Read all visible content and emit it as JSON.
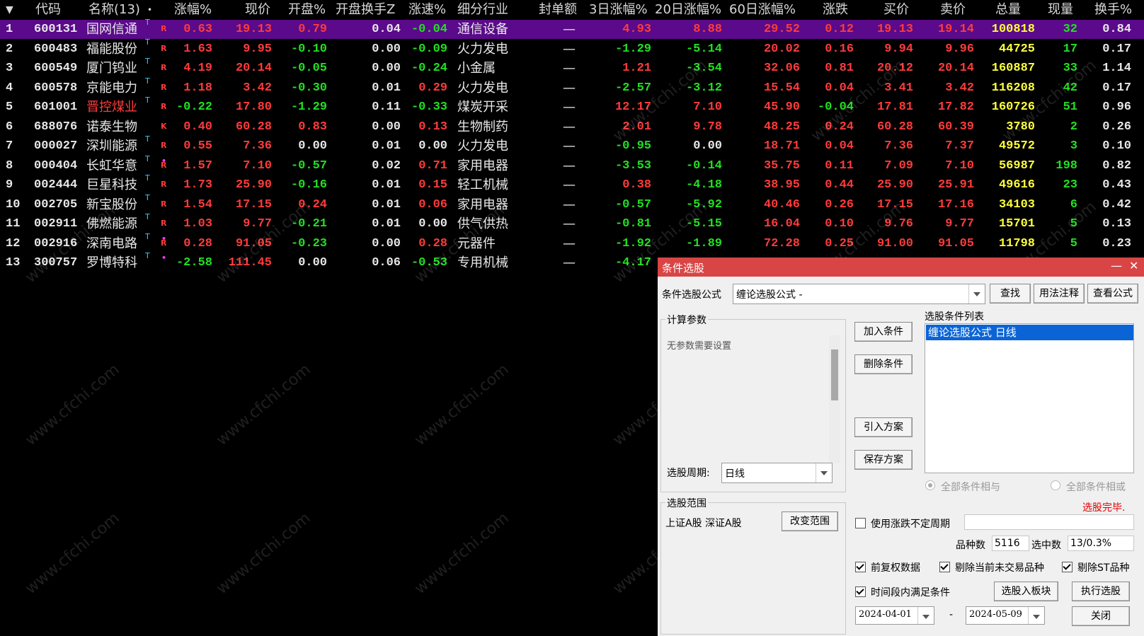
{
  "table": {
    "header": {
      "sort_arrow": "▼",
      "code": "代码",
      "name": "名称(13)",
      "name_dot": "•",
      "chg": "涨幅%",
      "price": "现价",
      "open_pct": "开盘%",
      "open_turn": "开盘换手Z",
      "speed": "涨速%",
      "industry": "细分行业",
      "seal": "封单额",
      "d3": "3日涨幅%",
      "d20": "20日涨幅%",
      "d60": "60日涨幅%",
      "updown": "涨跌",
      "bid": "买价",
      "ask": "卖价",
      "vol": "总量",
      "cur": "现量",
      "turn": "换手%"
    },
    "rows": [
      {
        "no": "1",
        "code": "600131",
        "name": "国网信通",
        "t": "T",
        "mark": "R",
        "chg": "0.63",
        "price": "19.13",
        "open": "0.79",
        "oturn": "0.04",
        "speed": "-0.04",
        "ind": "通信设备",
        "seal": "—",
        "d3": "4.93",
        "d20": "8.88",
        "d60": "29.52",
        "ud": "0.12",
        "bid": "19.13",
        "ask": "19.14",
        "vol": "100818",
        "cur": "32",
        "turn": "0.84",
        "selected": true
      },
      {
        "no": "2",
        "code": "600483",
        "name": "福能股份",
        "t": "T",
        "mark": "R",
        "chg": "1.63",
        "price": "9.95",
        "open": "-0.10",
        "oturn": "0.00",
        "speed": "-0.09",
        "ind": "火力发电",
        "seal": "—",
        "d3": "-1.29",
        "d20": "-5.14",
        "d60": "20.02",
        "ud": "0.16",
        "bid": "9.94",
        "ask": "9.96",
        "vol": "44725",
        "cur": "17",
        "turn": "0.17"
      },
      {
        "no": "3",
        "code": "600549",
        "name": "厦门钨业",
        "t": "T",
        "mark": "R",
        "chg": "4.19",
        "price": "20.14",
        "open": "-0.05",
        "oturn": "0.00",
        "speed": "-0.24",
        "ind": "小金属",
        "seal": "—",
        "d3": "1.21",
        "d20": "-3.54",
        "d60": "32.06",
        "ud": "0.81",
        "bid": "20.12",
        "ask": "20.14",
        "vol": "160887",
        "cur": "33",
        "turn": "1.14"
      },
      {
        "no": "4",
        "code": "600578",
        "name": "京能电力",
        "t": "T",
        "mark": "R",
        "chg": "1.18",
        "price": "3.42",
        "open": "-0.30",
        "oturn": "0.01",
        "speed": "0.29",
        "ind": "火力发电",
        "seal": "—",
        "d3": "-2.57",
        "d20": "-3.12",
        "d60": "15.54",
        "ud": "0.04",
        "bid": "3.41",
        "ask": "3.42",
        "vol": "116208",
        "cur": "42",
        "turn": "0.17"
      },
      {
        "no": "5",
        "code": "601001",
        "name": "晋控煤业",
        "t": "T",
        "mark": "R",
        "chg": "-0.22",
        "price": "17.80",
        "open": "-1.29",
        "oturn": "0.11",
        "speed": "-0.33",
        "ind": "煤炭开采",
        "seal": "—",
        "d3": "12.17",
        "d20": "7.10",
        "d60": "45.90",
        "ud": "-0.04",
        "bid": "17.81",
        "ask": "17.82",
        "vol": "160726",
        "cur": "51",
        "turn": "0.96",
        "name_red": true
      },
      {
        "no": "6",
        "code": "688076",
        "name": "诺泰生物",
        "t": "",
        "mark": "K",
        "chg": "0.40",
        "price": "60.28",
        "open": "0.83",
        "oturn": "0.00",
        "speed": "0.13",
        "ind": "生物制药",
        "seal": "—",
        "d3": "2.01",
        "d20": "9.78",
        "d60": "48.25",
        "ud": "0.24",
        "bid": "60.28",
        "ask": "60.39",
        "vol": "3780",
        "cur": "2",
        "turn": "0.26"
      },
      {
        "no": "7",
        "code": "000027",
        "name": "深圳能源",
        "t": "T",
        "mark": "R",
        "chg": "0.55",
        "price": "7.36",
        "open": "0.00",
        "oturn": "0.01",
        "speed": "0.00",
        "ind": "火力发电",
        "seal": "—",
        "d3": "-0.95",
        "d20": "0.00",
        "d60": "18.71",
        "ud": "0.04",
        "bid": "7.36",
        "ask": "7.37",
        "vol": "49572",
        "cur": "3",
        "turn": "0.10"
      },
      {
        "no": "8",
        "code": "000404",
        "name": "长虹华意",
        "t": "T",
        "mark": "R",
        "chg": "1.57",
        "price": "7.10",
        "open": "-0.57",
        "oturn": "0.02",
        "speed": "0.71",
        "ind": "家用电器",
        "seal": "—",
        "d3": "-3.53",
        "d20": "-0.14",
        "d60": "35.75",
        "ud": "0.11",
        "bid": "7.09",
        "ask": "7.10",
        "vol": "56987",
        "cur": "198",
        "turn": "0.82",
        "dot": true
      },
      {
        "no": "9",
        "code": "002444",
        "name": "巨星科技",
        "t": "T",
        "mark": "R",
        "chg": "1.73",
        "price": "25.90",
        "open": "-0.16",
        "oturn": "0.01",
        "speed": "0.15",
        "ind": "轻工机械",
        "seal": "—",
        "d3": "0.38",
        "d20": "-4.18",
        "d60": "38.95",
        "ud": "0.44",
        "bid": "25.90",
        "ask": "25.91",
        "vol": "49616",
        "cur": "23",
        "turn": "0.43"
      },
      {
        "no": "10",
        "code": "002705",
        "name": "新宝股份",
        "t": "T",
        "mark": "R",
        "chg": "1.54",
        "price": "17.15",
        "open": "0.24",
        "oturn": "0.01",
        "speed": "0.06",
        "ind": "家用电器",
        "seal": "—",
        "d3": "-0.57",
        "d20": "-5.92",
        "d60": "40.46",
        "ud": "0.26",
        "bid": "17.15",
        "ask": "17.16",
        "vol": "34103",
        "cur": "6",
        "turn": "0.42"
      },
      {
        "no": "11",
        "code": "002911",
        "name": "佛燃能源",
        "t": "T",
        "mark": "R",
        "chg": "1.03",
        "price": "9.77",
        "open": "-0.21",
        "oturn": "0.01",
        "speed": "0.00",
        "ind": "供气供热",
        "seal": "—",
        "d3": "-0.81",
        "d20": "-5.15",
        "d60": "16.04",
        "ud": "0.10",
        "bid": "9.76",
        "ask": "9.77",
        "vol": "15701",
        "cur": "5",
        "turn": "0.13"
      },
      {
        "no": "12",
        "code": "002916",
        "name": "深南电路",
        "t": "T",
        "mark": "R",
        "chg": "0.28",
        "price": "91.05",
        "open": "-0.23",
        "oturn": "0.00",
        "speed": "0.28",
        "ind": "元器件",
        "seal": "—",
        "d3": "-1.92",
        "d20": "-1.89",
        "d60": "72.28",
        "ud": "0.25",
        "bid": "91.00",
        "ask": "91.05",
        "vol": "11798",
        "cur": "5",
        "turn": "0.23",
        "dot": true
      },
      {
        "no": "13",
        "code": "300757",
        "name": "罗博特科",
        "t": "T",
        "mark": "",
        "chg": "-2.58",
        "price": "111.45",
        "open": "0.00",
        "oturn": "0.06",
        "speed": "-0.53",
        "ind": "专用机械",
        "seal": "—",
        "d3": "-4.17",
        "d20": "",
        "d60": "",
        "ud": "",
        "bid": "",
        "ask": "",
        "vol": "",
        "cur": "",
        "turn": "",
        "dot": true
      }
    ]
  },
  "watermark": "www.cfchi.com",
  "colors": {
    "up": "#ff3b3b",
    "down": "#22e022",
    "flat": "#e8e8e8",
    "volume": "#ffff3c",
    "cur_volume": "#22e022",
    "industry": "#e8e8e8",
    "code": "#e8e8e8",
    "selected_row": "#5a0a8a",
    "dialog_title_bg": "#d94545"
  },
  "dialog": {
    "title": "条件选股",
    "minimize": "—",
    "close_x": "✕",
    "formula_label": "条件选股公式",
    "formula_value": "缠论选股公式 -",
    "find_btn": "查找",
    "usage_btn": "用法注释",
    "view_btn": "查看公式",
    "calc_params_title": "计算参数",
    "no_params_text": "无参数需要设置",
    "period_label": "选股周期:",
    "period_value": "日线",
    "add_btn": "加入条件",
    "delete_btn": "删除条件",
    "import_btn": "引入方案",
    "save_btn": "保存方案",
    "cond_list_title": "选股条件列表",
    "cond_items": [
      "缠论选股公式  日线"
    ],
    "radio_and": "全部条件相与",
    "radio_or": "全部条件相或",
    "status": "选股完毕.",
    "scope_title": "选股范围",
    "scope_value": "上证A股 深证A股",
    "change_scope_btn": "改变范围",
    "use_period_label": "使用涨跌不定周期",
    "count_label": "品种数",
    "count_value": "5116",
    "selected_label": "选中数",
    "selected_value": "13/0.3%",
    "fq_label": "前复权数据",
    "exclude_untraded_label": "剔除当前未交易品种",
    "exclude_st_label": "剔除ST品种",
    "time_range_label": "时间段内满足条件",
    "to_block_btn": "选股入板块",
    "run_btn": "执行选股",
    "date_from": "2024-04-01",
    "date_sep": "-",
    "date_to": "2024-05-09",
    "close_btn": "关闭"
  }
}
